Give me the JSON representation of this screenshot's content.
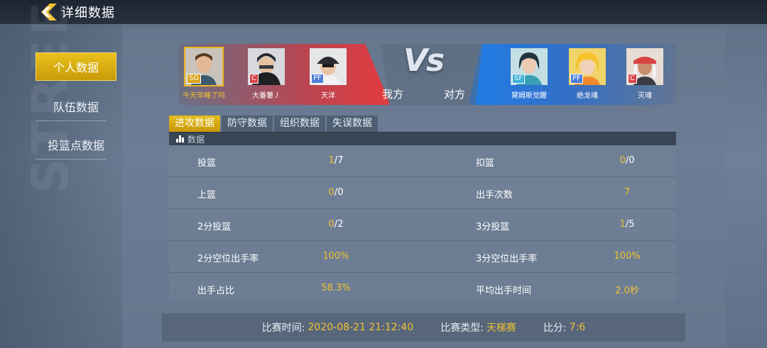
{
  "header": {
    "title": "详细数据",
    "back_icon": "chevron-left-icon",
    "accent": "#f1c232"
  },
  "nav": {
    "items": [
      {
        "label": "个人数据",
        "active": true
      },
      {
        "label": "队伍数据",
        "active": false
      },
      {
        "label": "投篮点数据",
        "active": false
      }
    ]
  },
  "match": {
    "vs_text": "Vs",
    "my_side": "我方",
    "opp_side": "对方",
    "my_team": [
      {
        "name": "今天早睡了吗",
        "pos": "SG",
        "pos_color": "#d9a21a",
        "selected": true
      },
      {
        "name": "大番薯丿",
        "pos": "C",
        "pos_color": "#d9434a",
        "selected": false
      },
      {
        "name": "天洋",
        "pos": "PF",
        "pos_color": "#4f7ed8",
        "selected": false
      }
    ],
    "opp_team": [
      {
        "name": "黛姆斯觉醒",
        "pos": "SF",
        "pos_color": "#3bb0d6",
        "selected": false
      },
      {
        "name": "绝龙魂",
        "pos": "PF",
        "pos_color": "#4f7ed8",
        "selected": false
      },
      {
        "name": "灭魂",
        "pos": "C",
        "pos_color": "#d9434a",
        "selected": false
      }
    ]
  },
  "tabs": [
    {
      "label": "进攻数据",
      "active": true
    },
    {
      "label": "防守数据",
      "active": false
    },
    {
      "label": "组织数据",
      "active": false
    },
    {
      "label": "失误数据",
      "active": false
    }
  ],
  "stats": {
    "header": "数据",
    "rows": [
      {
        "l_label": "投篮",
        "l_made": "1",
        "l_total": "7",
        "r_label": "扣篮",
        "r_made": "0",
        "r_total": "0"
      },
      {
        "l_label": "上篮",
        "l_made": "0",
        "l_total": "0",
        "r_label": "出手次数",
        "r_value": "7"
      },
      {
        "l_label": "2分投篮",
        "l_made": "0",
        "l_total": "2",
        "r_label": "3分投篮",
        "r_made": "1",
        "r_total": "5"
      },
      {
        "l_label": "2分空位出手率",
        "l_value": "100%",
        "r_label": "3分空位出手率",
        "r_value": "100%"
      },
      {
        "l_label": "出手占比",
        "l_value": "58.3%",
        "r_label": "平均出手时间",
        "r_value": "2.0秒"
      }
    ]
  },
  "footer": {
    "time_label": "比赛时间:",
    "time_value": "2020-08-21 21:12:40",
    "type_label": "比赛类型:",
    "type_value": "天梯赛",
    "score_label": "比分:",
    "score_value": "7:6"
  }
}
